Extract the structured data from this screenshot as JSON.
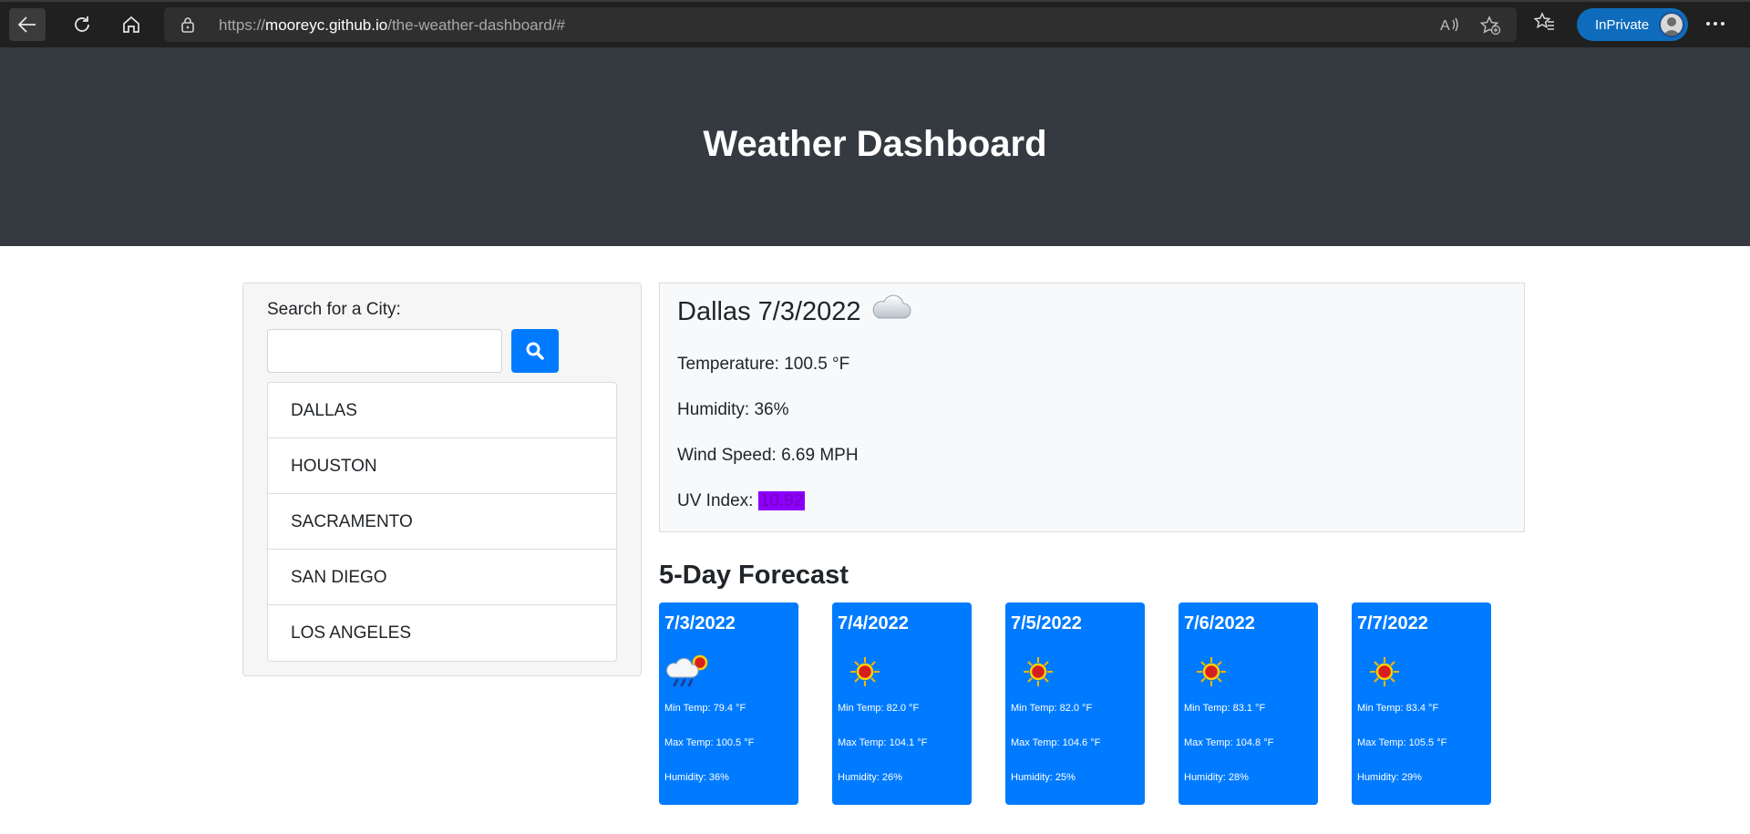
{
  "browser": {
    "url_scheme": "https://",
    "url_host": "mooreyc.github.io",
    "url_path": "/the-weather-dashboard/#",
    "inprivate_label": "InPrivate"
  },
  "header": {
    "title": "Weather Dashboard"
  },
  "search": {
    "label": "Search for a City:",
    "value": "",
    "cities": [
      "DALLAS",
      "HOUSTON",
      "SACRAMENTO",
      "SAN DIEGO",
      "LOS ANGELES"
    ]
  },
  "current": {
    "title": "Dallas 7/3/2022",
    "icon": "cloud-icon",
    "temperature": "Temperature: 100.5 °F",
    "humidity": "Humidity: 36%",
    "wind": "Wind Speed: 6.69 MPH",
    "uv_label": "UV Index: ",
    "uv_value": "10.92"
  },
  "forecast": {
    "title": "5-Day Forecast",
    "days": [
      {
        "date": "7/3/2022",
        "icon": "rain-sun-icon",
        "min": "Min Temp: 79.4 °F",
        "max": "Max Temp: 100.5 °F",
        "humidity": "Humidity: 36%"
      },
      {
        "date": "7/4/2022",
        "icon": "sun-icon",
        "min": "Min Temp: 82.0 °F",
        "max": "Max Temp: 104.1 °F",
        "humidity": "Humidity: 26%"
      },
      {
        "date": "7/5/2022",
        "icon": "sun-icon",
        "min": "Min Temp: 82.0 °F",
        "max": "Max Temp: 104.6 °F",
        "humidity": "Humidity: 25%"
      },
      {
        "date": "7/6/2022",
        "icon": "sun-icon",
        "min": "Min Temp: 83.1 °F",
        "max": "Max Temp: 104.8 °F",
        "humidity": "Humidity: 28%"
      },
      {
        "date": "7/7/2022",
        "icon": "sun-icon",
        "min": "Min Temp: 83.4 °F",
        "max": "Max Temp: 105.5 °F",
        "humidity": "Humidity: 29%"
      }
    ]
  },
  "colors": {
    "header_bg": "#343a40",
    "accent_blue": "#007bff",
    "uv_badge": "#8b00ff"
  }
}
